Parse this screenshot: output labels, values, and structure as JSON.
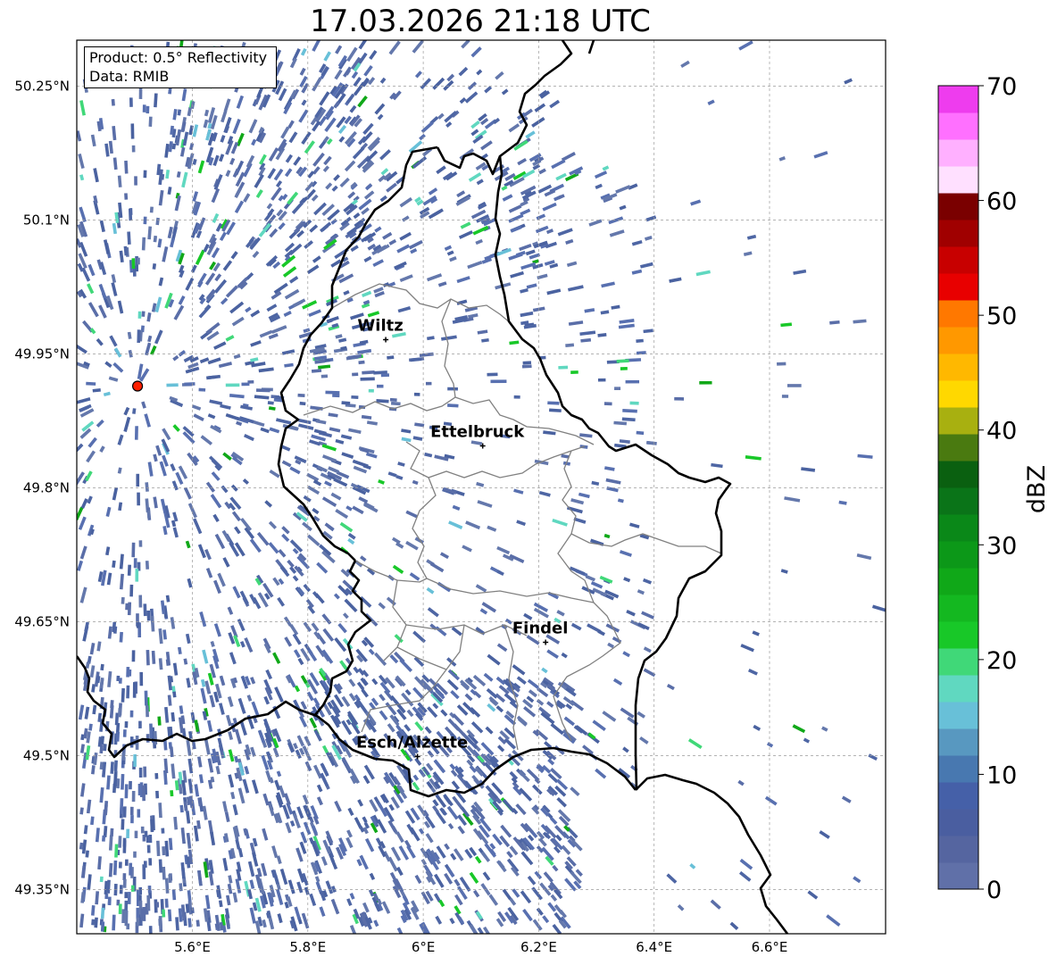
{
  "title": "17.03.2026 21:18 UTC",
  "infobox": {
    "product": "Product: 0.5° Reflectivity",
    "data": "Data: RMIB"
  },
  "axes": {
    "lat_ticks": [
      "50.25°N",
      "50.1°N",
      "49.95°N",
      "49.8°N",
      "49.65°N",
      "49.5°N",
      "49.35°N"
    ],
    "lon_ticks": [
      "5.6°E",
      "5.8°E",
      "6°E",
      "6.2°E",
      "6.4°E",
      "6.6°E"
    ],
    "lat_values": [
      50.25,
      50.1,
      49.95,
      49.8,
      49.65,
      49.5,
      49.35
    ],
    "lon_values": [
      5.6,
      5.8,
      6.0,
      6.2,
      6.4,
      6.6
    ],
    "grid": true
  },
  "cities": [
    {
      "name": "Wiltz",
      "lon": 5.935,
      "lat": 49.966
    },
    {
      "name": "Ettelbruck",
      "lon": 6.103,
      "lat": 49.847
    },
    {
      "name": "Findel",
      "lon": 6.212,
      "lat": 49.627
    },
    {
      "name": "Esch/Alzette",
      "lon": 5.99,
      "lat": 49.499
    }
  ],
  "radar_site": {
    "lon": 5.505,
    "lat": 49.914
  },
  "colorbar": {
    "label": "dBZ",
    "ticks": [
      "0",
      "10",
      "20",
      "30",
      "40",
      "50",
      "60",
      "70"
    ],
    "min": 0,
    "max": 70,
    "colors": [
      "#6070a8",
      "#5565a0",
      "#4a5ea0",
      "#4560a8",
      "#4878b0",
      "#5898c0",
      "#68c0d8",
      "#60d8c0",
      "#40d878",
      "#18c828",
      "#14b820",
      "#10a818",
      "#0c9818",
      "#0a8818",
      "#0a7418",
      "#0a6010",
      "#4a7a10",
      "#a8b010",
      "#ffd800",
      "#ffb800",
      "#ff9800",
      "#ff7800",
      "#e80000",
      "#c80000",
      "#a00000",
      "#7a0000",
      "#ffe0ff",
      "#ffb0ff",
      "#ff70ff",
      "#ee3cee"
    ]
  }
}
